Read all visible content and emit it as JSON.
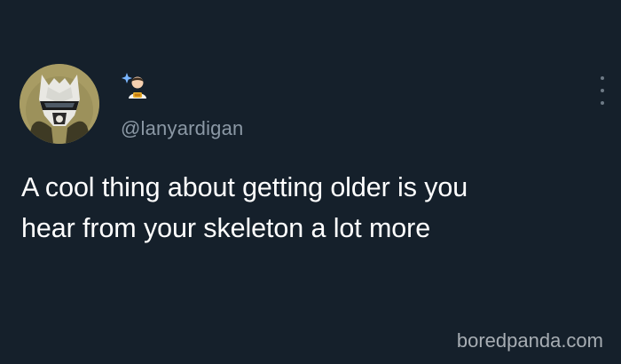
{
  "tweet": {
    "handle": "@lanyardigan",
    "lines": [
      "A cool thing about getting older is you",
      "hear from your skeleton a lot more"
    ]
  },
  "icons": {
    "avatar": "armored-knight-avatar",
    "name": "person-with-sparkle-emoji",
    "more": "vertical-ellipsis-icon"
  },
  "colors": {
    "background": "#15202b",
    "text": "#ffffff",
    "muted": "#8b98a5"
  },
  "watermark": {
    "text": "boredpanda.com"
  }
}
